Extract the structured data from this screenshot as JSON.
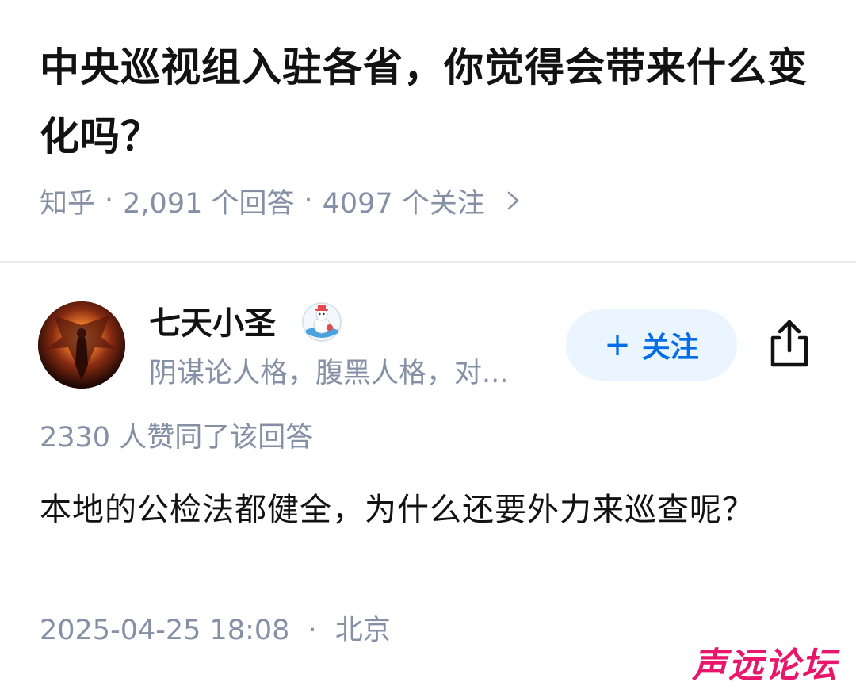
{
  "question": {
    "title": "中央巡视组入驻各省，你觉得会带来什么变化吗？",
    "source": "知乎",
    "answer_count": "2,091 个回答",
    "follower_count": "4097 个关注",
    "separator": "·"
  },
  "answer": {
    "author": {
      "name": "七天小圣",
      "bio": "阴谋论人格，腹黑人格，对...",
      "badge_icon": "snowman-badge-icon"
    },
    "follow_button_label": "关注",
    "follow_button_icon": "plus-icon",
    "share_icon": "share-icon",
    "vote_text": "2330 人赞同了该回答",
    "body": "本地的公检法都健全，为什么还要外力来巡查呢？",
    "timestamp": "2025-04-25 18:08",
    "location": "北京",
    "separator": "·"
  },
  "watermark": "声远论坛",
  "colors": {
    "primary_text": "#121212",
    "secondary_text": "#8590a6",
    "accent_blue": "#056de8",
    "follow_bg": "#ebf5ff",
    "divider": "#ebebeb",
    "watermark": "#e8176b"
  }
}
